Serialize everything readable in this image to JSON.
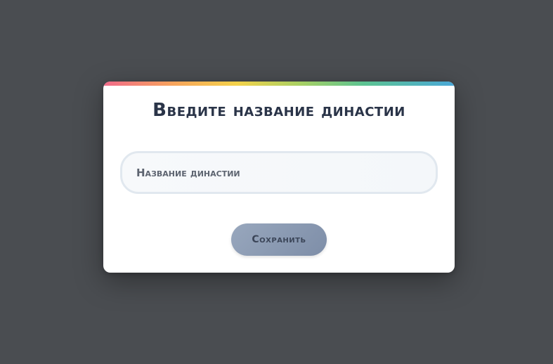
{
  "dialog": {
    "title": "Введите название династии",
    "input": {
      "placeholder": "Название династии",
      "value": ""
    },
    "save_label": "Сохранить"
  },
  "colors": {
    "backdrop": "#4a4d51",
    "card": "#ffffff",
    "title_text": "#2a3448",
    "button_bg": "#8a99b2",
    "rainbow": [
      "#f06a8a",
      "#f7a45c",
      "#f4d24a",
      "#a8d063",
      "#5cc391",
      "#4aa8d8"
    ]
  }
}
